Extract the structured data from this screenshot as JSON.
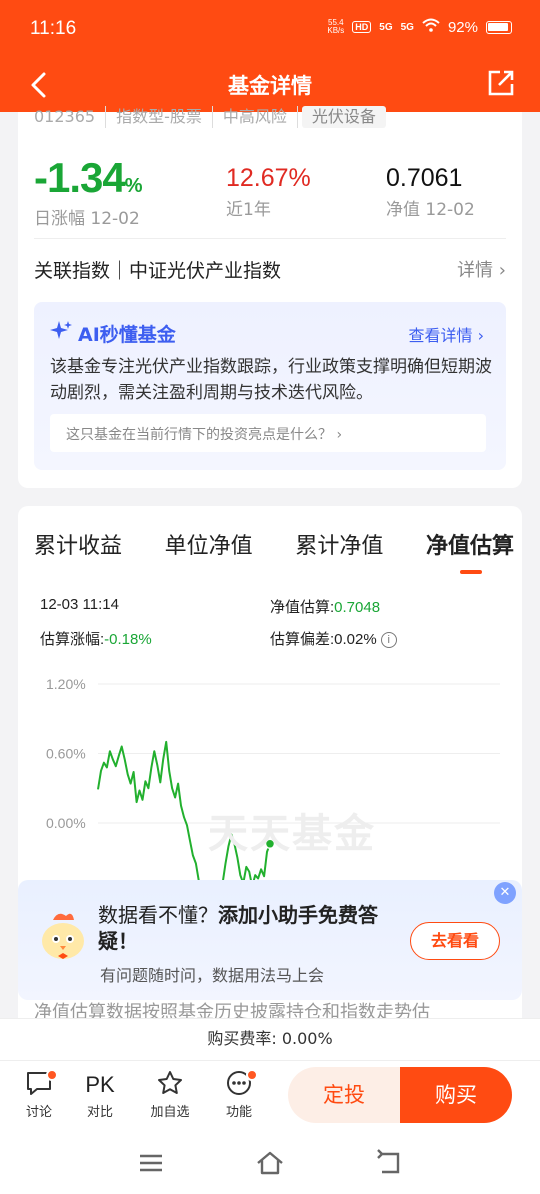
{
  "status": {
    "time": "11:16",
    "speed_top": "55.4",
    "speed_bottom": "KB/s",
    "hd": "HD",
    "net1": "5G",
    "net2": "5G",
    "battery": "92%"
  },
  "nav": {
    "title": "基金详情"
  },
  "summary": {
    "tags": [
      "012365",
      "指数型-股票",
      "中高风险",
      "光伏设备"
    ],
    "daily_change_value": "-1.34",
    "daily_change_unit": "%",
    "daily_change_label": "日涨幅 12-02",
    "year_return_value": "12.67%",
    "year_return_label": "近1年",
    "nav_value": "0.7061",
    "nav_label": "净值 12-02",
    "index_text": "关联指数｜中证光伏产业指数",
    "index_detail": "详情"
  },
  "ai": {
    "title": "AI秒懂基金",
    "more": "查看详情",
    "text": "该基金专注光伏产业指数跟踪，行业政策支撑明确但短期波动剧烈，需关注盈利周期与技术迭代风险。",
    "question": "这只基金在当前行情下的投资亮点是什么？"
  },
  "chart_section": {
    "tabs": [
      "累计收益",
      "单位净值",
      "累计净值",
      "净值估算"
    ],
    "active_tab": 3,
    "time": "12-03 11:14",
    "est_value_label": "净值估算:",
    "est_value": "0.7048",
    "est_change_label": "估算涨幅:",
    "est_change": "-0.18%",
    "est_dev_label": "估算偏差:",
    "est_dev": "0.02%",
    "watermark": "天天基金"
  },
  "chart_data": {
    "type": "line",
    "title": "",
    "xlabel": "",
    "ylabel": "",
    "y_ticks": [
      "1.20%",
      "0.60%",
      "0.00%"
    ],
    "ylim": [
      -0.7,
      1.2
    ],
    "grid": true,
    "series": [
      {
        "values": [
          0.29,
          0.45,
          0.52,
          0.48,
          0.62,
          0.55,
          0.49,
          0.58,
          0.66,
          0.55,
          0.42,
          0.34,
          0.44,
          0.18,
          0.28,
          0.2,
          0.36,
          0.3,
          0.48,
          0.62,
          0.5,
          0.35,
          0.55,
          0.7,
          0.45,
          0.3,
          0.22,
          0.34,
          0.15,
          0.05,
          -0.02,
          -0.15,
          -0.28,
          -0.35,
          -0.5,
          -0.62,
          -0.7,
          -0.66,
          -0.7,
          -0.6,
          -0.55,
          -0.68,
          -0.52,
          -0.35,
          -0.2,
          -0.1,
          -0.18,
          -0.3,
          -0.45,
          -0.52,
          -0.38,
          -0.42,
          -0.55,
          -0.45,
          -0.48,
          -0.4,
          -0.46,
          -0.25,
          -0.18
        ]
      }
    ]
  },
  "promo": {
    "line1_plain": "数据看不懂？",
    "line1_bold": "添加小助手免费答疑！",
    "sub": "有问题随时问，数据用法马上会",
    "button": "去看看",
    "below_text": "净值估算数据按照基金历史披露持仓和指数走势估"
  },
  "fee": {
    "text": "购买费率: 0.00%"
  },
  "bottom": {
    "items": [
      "讨论",
      "对比",
      "加自选",
      "功能"
    ],
    "pk": "PK",
    "ding": "定投",
    "buy": "购买"
  },
  "colors": {
    "brand": "#ff4b12",
    "up": "#e02a22",
    "down": "#1aa636",
    "ai": "#3d5ef0"
  }
}
